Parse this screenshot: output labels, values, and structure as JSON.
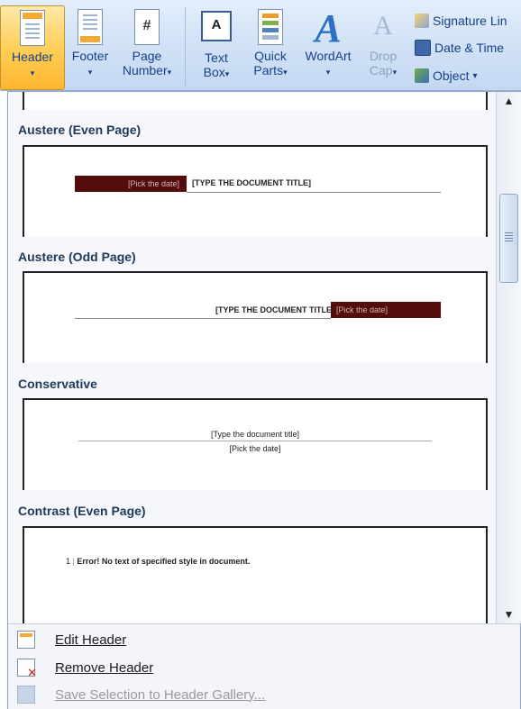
{
  "ribbon": {
    "header_label": "Header",
    "footer_label": "Footer",
    "page_number_label1": "Page",
    "page_number_label2": "Number",
    "text_box_label1": "Text",
    "text_box_label2": "Box",
    "quick_parts_label1": "Quick",
    "quick_parts_label2": "Parts",
    "wordart_label": "WordArt",
    "drop_cap_label1": "Drop",
    "drop_cap_label2": "Cap",
    "signature_line_label": "Signature Lin",
    "date_time_label": "Date & Time",
    "object_label": "Object",
    "caret": "▾",
    "page_number_glyph": "#",
    "text_box_glyph": "A",
    "wordart_glyph": "A",
    "drop_cap_glyph": "A"
  },
  "gallery": {
    "sections": [
      {
        "title": "Austere (Even Page)",
        "date": "[Pick the date]",
        "doc_title": "[TYPE THE DOCUMENT TITLE]"
      },
      {
        "title": "Austere (Odd Page)",
        "date": "[Pick the date]",
        "doc_title": "[TYPE THE DOCUMENT TITLE]"
      },
      {
        "title": "Conservative",
        "doc_title": "[Type the document title]",
        "date": "[Pick the date]"
      },
      {
        "title": "Contrast (Even Page)",
        "page_num": "1",
        "error_text": "Error! No text of specified style in document."
      }
    ]
  },
  "menu": {
    "edit_header": "Edit Header",
    "remove_header": "Remove Header",
    "save_selection": "Save Selection to Header Gallery..."
  },
  "colors": {
    "ribbon_bg": "#d3e3f7",
    "active_button": "#ffcf5a",
    "austere_bar": "#540c0c"
  }
}
